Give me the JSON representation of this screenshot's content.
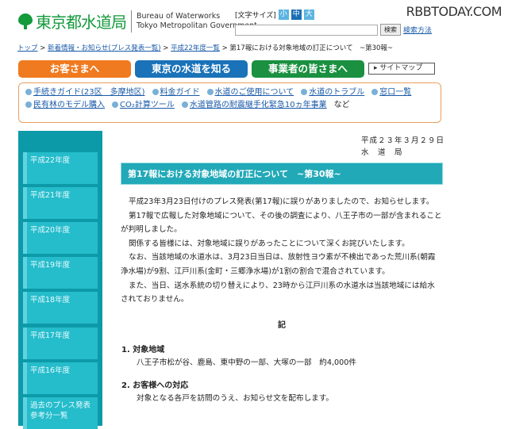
{
  "header": {
    "logo_jp": "東京都水道局",
    "logo_en1": "Bureau of Waterworks",
    "logo_en2": "Tokyo Metropolitan Government",
    "font_size_label": "[文字サイズ]",
    "font_sizes": [
      "小",
      "中",
      "大"
    ],
    "search_placeholder": "",
    "search_button": "検索",
    "search_help": "検索方法",
    "brand": "RBBTODAY.COM"
  },
  "breadcrumb": {
    "items": [
      "トップ",
      "新着情報・お知らせ(プレス発表一覧)",
      "平成22年度一覧"
    ],
    "sep": ">",
    "current": "第17報における対象地域の訂正について　~第30報~"
  },
  "nav": {
    "tabs": [
      "お客さまへ",
      "東京の水道を知る",
      "事業者の皆さまへ"
    ],
    "sitemap": "▸ サイトマップ",
    "colors": [
      "#f07a20",
      "#1a72b8",
      "#1a9040"
    ]
  },
  "sublinks": {
    "row1": [
      "手続きガイド(23区　多摩地区)",
      "料金ガイド",
      "水道のご使用について",
      "水道のトラブル",
      "窓口一覧"
    ],
    "row2": [
      "民有林のモデル購入",
      "CO₂計算ツール",
      "水道管路の耐震継手化緊急10ヵ年事業"
    ],
    "etc": "など"
  },
  "sidebar": {
    "items": [
      "平成22年度",
      "平成21年度",
      "平成20年度",
      "平成19年度",
      "平成18年度",
      "平成17年度",
      "平成16年度",
      "過去のプレス発表参考分一覧"
    ]
  },
  "main": {
    "date": "平成２３年３月２９日",
    "org": "水　道　局",
    "title": "第17報における対象地域の訂正について　~第30報~",
    "paragraphs": [
      "平成23年3月23日付けのプレス発表(第17報)に誤りがありましたので、お知らせします。",
      "第17報で広報した対象地域について、その後の調査により、八王子市の一部が含まれることが判明しました。",
      "関係する皆様には、対象地域に誤りがあったことについて深くお詫びいたします。",
      "なお、当該地域の水道水は、3月23日当日は、放射性ヨウ素が不検出であった荒川系(朝霞浄水場)が9割、江戸川系(金町・三郷浄水場)が1割の割合で混合されています。",
      "また、当日、送水系統の切り替えにより、23時から江戸川系の水道水は当該地域には給水されておりません。"
    ],
    "ki": "記",
    "section1_heading": "1. 対象地域",
    "section1_text": "八王子市松が谷、鹿島、東中野の一部、大塚の一部　約4,000件",
    "section2_heading": "2. お客様への対応",
    "section2_text": "対象となる各戸を訪問のうえ、お知らせ文を配布します。"
  }
}
